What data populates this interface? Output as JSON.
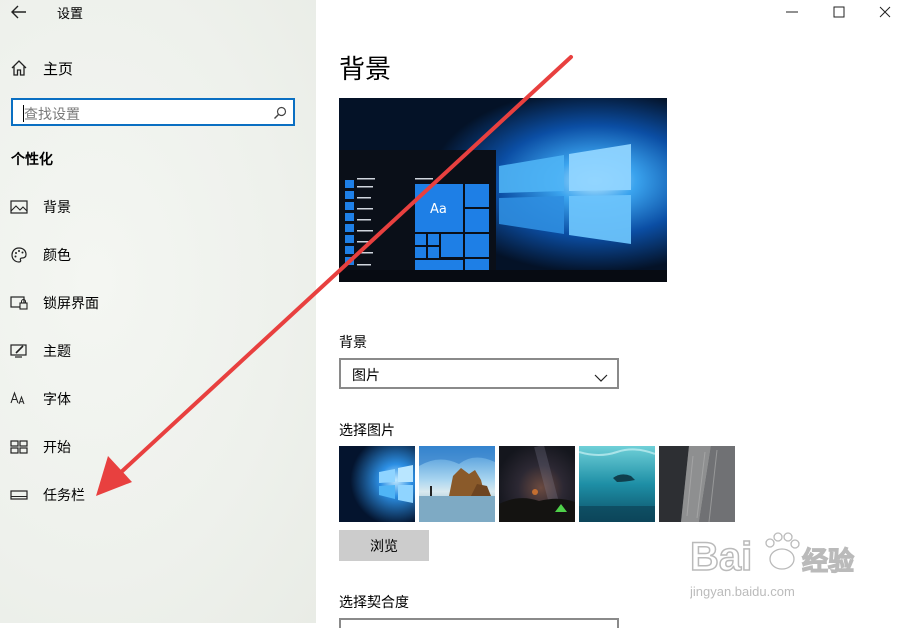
{
  "window": {
    "title": "设置",
    "controls": [
      "minimize-icon",
      "maximize-icon",
      "close-icon"
    ]
  },
  "sidebar": {
    "home_label": "主页",
    "search": {
      "placeholder": "查找设置"
    },
    "section_title": "个性化",
    "items": [
      {
        "label": "背景",
        "icon": "picture-icon"
      },
      {
        "label": "颜色",
        "icon": "palette-icon"
      },
      {
        "label": "锁屏界面",
        "icon": "lock-screen-icon"
      },
      {
        "label": "主题",
        "icon": "theme-icon"
      },
      {
        "label": "字体",
        "icon": "font-icon"
      },
      {
        "label": "开始",
        "icon": "start-icon"
      },
      {
        "label": "任务栏",
        "icon": "taskbar-icon"
      }
    ]
  },
  "main": {
    "title": "背景",
    "preview": {
      "tile_text": "Aa"
    },
    "background_label": "背景",
    "background_value": "图片",
    "choose_picture_label": "选择图片",
    "pictures": [
      "windows-hero",
      "beach-rocks",
      "night-sky-tent",
      "underwater-swimmer",
      "rock-cliff"
    ],
    "browse_label": "浏览",
    "fit_label": "选择契合度"
  },
  "annotation": {
    "color": "#e8403f"
  },
  "watermark": {
    "brand": "Bai",
    "brand2": "du",
    "cn": "经验",
    "url": "jingyan.baidu.com"
  },
  "colors": {
    "accent": "#0a6fc2",
    "sidebar_bg": "#eef1ec",
    "button_bg": "#cccccc"
  }
}
